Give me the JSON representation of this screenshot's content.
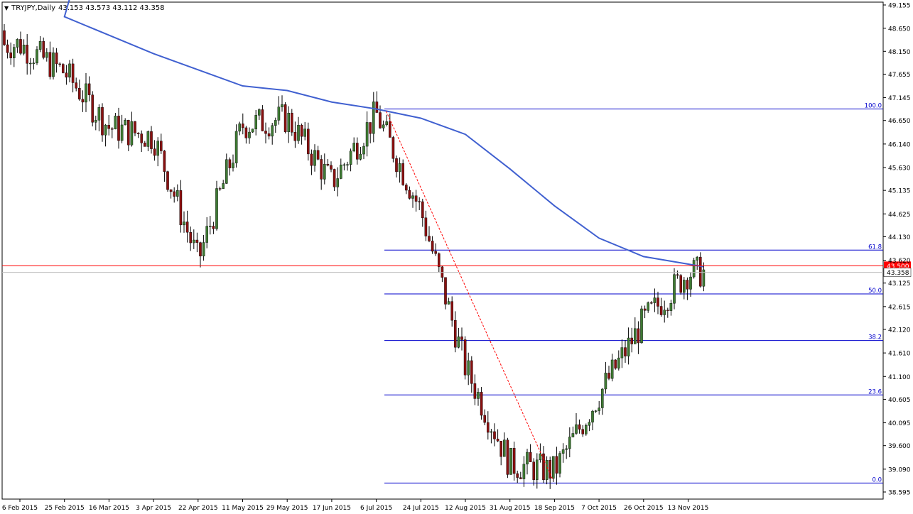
{
  "header": {
    "symbol_timeframe": "TRYJPY,Daily",
    "ohlc": "43.153 43.573 43.112 43.358"
  },
  "chart_data": {
    "type": "candlestick",
    "symbol": "TRYJPY",
    "timeframe": "Daily",
    "open": 43.153,
    "high": 43.573,
    "low": 43.112,
    "close": 43.358,
    "ylim": [
      38.595,
      49.155
    ],
    "y_ticks": [
      "49.155",
      "48.650",
      "48.150",
      "47.655",
      "47.145",
      "46.650",
      "46.140",
      "45.630",
      "45.135",
      "44.625",
      "44.130",
      "43.620",
      "43.125",
      "42.615",
      "42.120",
      "41.610",
      "41.100",
      "40.605",
      "40.095",
      "39.600",
      "39.090",
      "38.595"
    ],
    "x_ticks": [
      "6 Feb 2015",
      "25 Feb 2015",
      "16 Mar 2015",
      "3 Apr 2015",
      "22 Apr 2015",
      "11 May 2015",
      "29 May 2015",
      "17 Jun 2015",
      "6 Jul 2015",
      "24 Jul 2015",
      "12 Aug 2015",
      "31 Aug 2015",
      "18 Sep 2015",
      "7 Oct 2015",
      "26 Oct 2015",
      "13 Nov 2015"
    ],
    "price_line": {
      "value": 43.5,
      "label": "43.500",
      "color": "#ff0000"
    },
    "current_price": {
      "value": 43.358,
      "label": "43.358"
    },
    "fibonacci": {
      "color": "#0000cc",
      "levels": [
        {
          "label": "100.0",
          "value": 46.9
        },
        {
          "label": "61.8",
          "value": 43.84
        },
        {
          "label": "50.0",
          "value": 42.89
        },
        {
          "label": "38.2",
          "value": 41.88
        },
        {
          "label": "23.6",
          "value": 40.7
        },
        {
          "label": "0.0",
          "value": 38.79
        }
      ]
    },
    "trendline": {
      "color": "#ff0000",
      "style": "dashed",
      "from": {
        "date": "6 Jul 2015",
        "price": 46.85
      },
      "to": {
        "date": "18 Sep 2015",
        "price": 38.85
      }
    },
    "moving_average": {
      "color": "#4060d0",
      "points": [
        {
          "x": "before 6 Feb 2015",
          "y": 49.4
        },
        {
          "x": "25 Feb 2015",
          "y": 48.9
        },
        {
          "x": "16 Mar 2015",
          "y": 48.5
        },
        {
          "x": "3 Apr 2015",
          "y": 48.1
        },
        {
          "x": "22 Apr 2015",
          "y": 47.75
        },
        {
          "x": "11 May 2015",
          "y": 47.4
        },
        {
          "x": "29 May 2015",
          "y": 47.3
        },
        {
          "x": "17 Jun 2015",
          "y": 47.05
        },
        {
          "x": "6 Jul 2015",
          "y": 46.9
        },
        {
          "x": "24 Jul 2015",
          "y": 46.7
        },
        {
          "x": "12 Aug 2015",
          "y": 46.35
        },
        {
          "x": "31 Aug 2015",
          "y": 45.6
        },
        {
          "x": "18 Sep 2015",
          "y": 44.8
        },
        {
          "x": "7 Oct 2015",
          "y": 44.1
        },
        {
          "x": "26 Oct 2015",
          "y": 43.7
        },
        {
          "x": "13 Nov 2015",
          "y": 43.48
        }
      ]
    },
    "candle_colors": {
      "bull": "#3e7a33",
      "bear": "#8a1010",
      "wick": "#000000"
    },
    "candles": [
      {
        "date": "6 Feb 2015",
        "close": 48.3
      },
      {
        "date": "25 Feb 2015",
        "close": 47.7
      },
      {
        "date": "16 Mar 2015",
        "close": 46.5
      },
      {
        "date": "3 Apr 2015",
        "close": 46.3
      },
      {
        "date": "22 Apr 2015",
        "close": 43.6
      },
      {
        "date": "11 May 2015",
        "close": 46.55
      },
      {
        "date": "29 May 2015",
        "close": 46.7
      },
      {
        "date": "17 Jun 2015",
        "close": 45.3
      },
      {
        "date": "6 Jul 2015",
        "close": 46.8
      },
      {
        "date": "24 Jul 2015",
        "close": 44.7
      },
      {
        "date": "12 Aug 2015",
        "close": 41.3
      },
      {
        "date": "31 Aug 2015",
        "close": 39.2
      },
      {
        "date": "18 Sep 2015",
        "close": 39.05
      },
      {
        "date": "7 Oct 2015",
        "close": 40.7
      },
      {
        "date": "26 Oct 2015",
        "close": 42.3
      },
      {
        "date": "13 Nov 2015",
        "close": 43.358
      }
    ]
  }
}
